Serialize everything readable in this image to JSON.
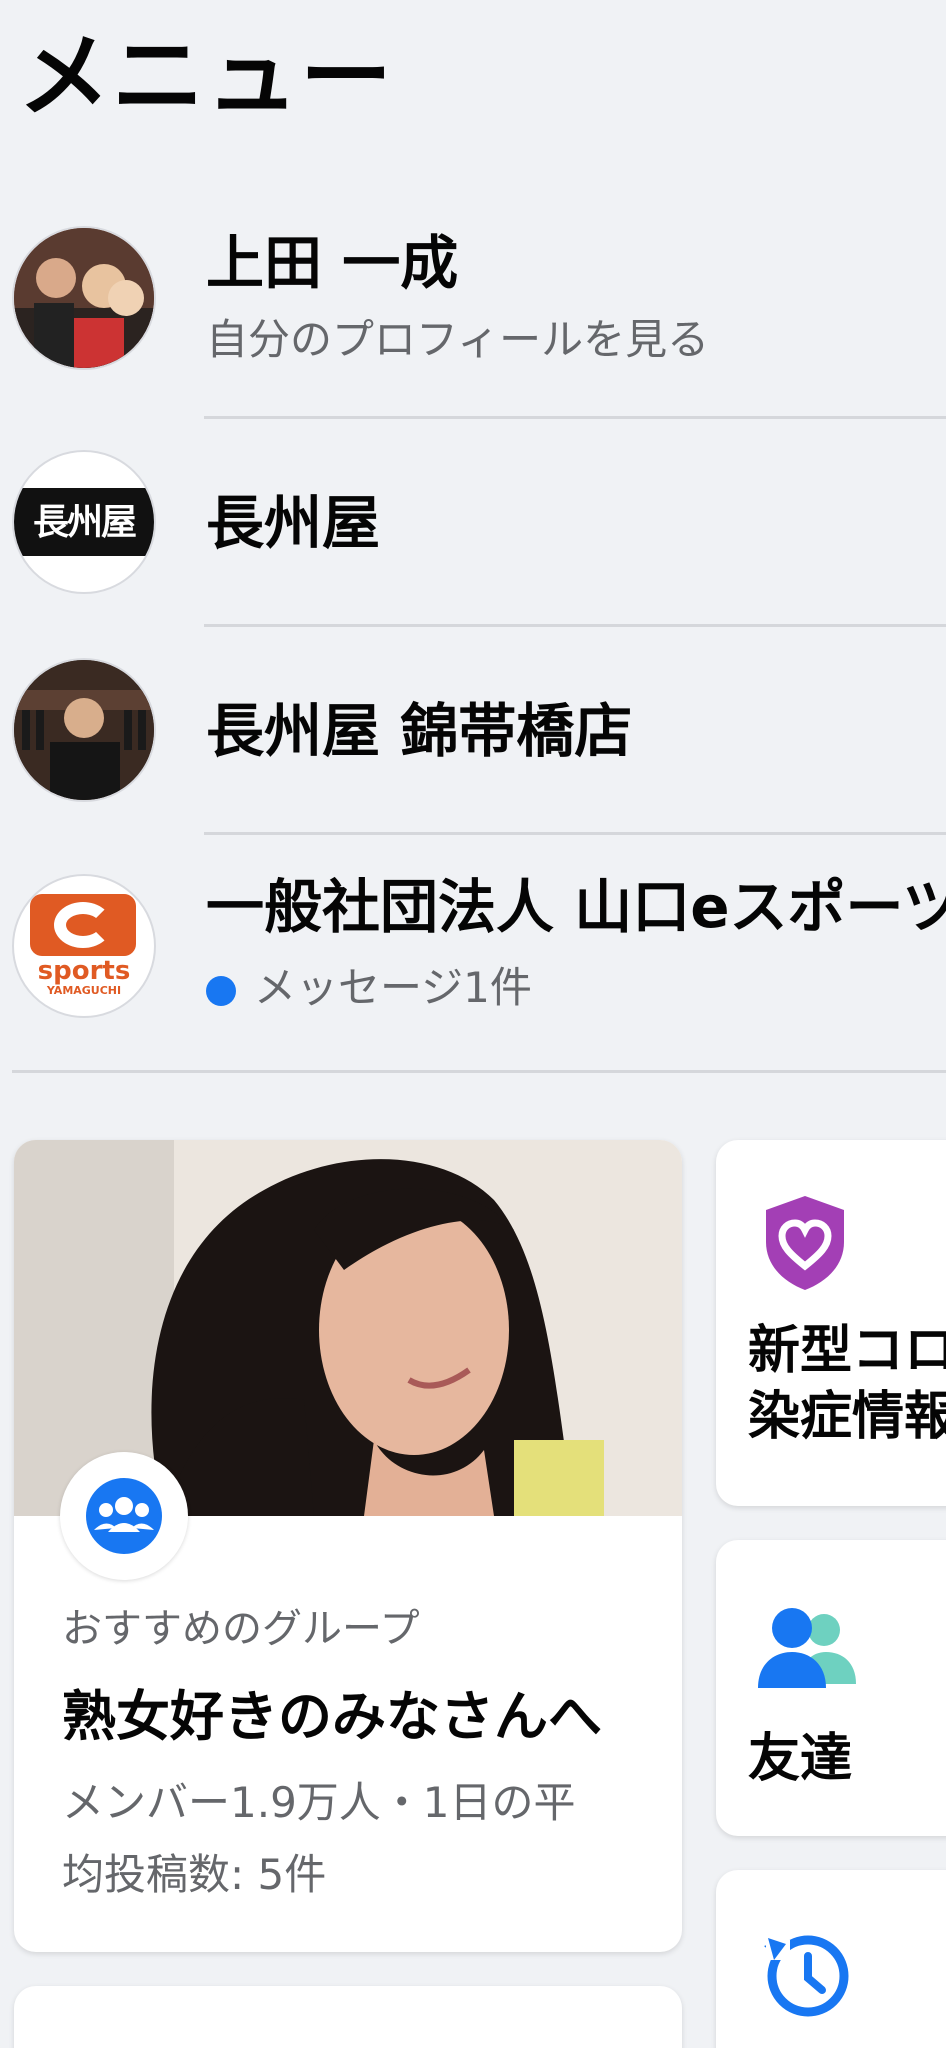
{
  "header": {
    "title": "メニュー"
  },
  "accounts": [
    {
      "name": "上田 一成",
      "subtitle": "自分のプロフィールを見る"
    },
    {
      "name": "長州屋"
    },
    {
      "name": "長州屋 錦帯橋店"
    },
    {
      "name": "一般社団法人 山口eスポーツ",
      "subtitle": "メッセージ1件",
      "logo_text": "sports",
      "logo_subtext": "YAMAGUCHI"
    }
  ],
  "avatar2_text": "長州屋",
  "group_card": {
    "category": "おすすめのグループ",
    "title": "熟女好きのみなさんへ",
    "meta_line1": "メンバー1.9万人・1日の平",
    "meta_line2": "均投稿数: 5件"
  },
  "shortcuts": [
    {
      "line1": "新型コロナウイルス感",
      "line2": "染症情報センター",
      "icon": "covid-heart-shield-icon"
    },
    {
      "line1": "友達",
      "icon": "friends-icon"
    },
    {
      "icon": "memories-clock-icon"
    }
  ],
  "colors": {
    "accent": "#1877f2",
    "secondary_text": "#65676b",
    "background": "#f0f2f5",
    "covid_purple": "#a33fb5",
    "esports_orange": "#e05a23"
  }
}
